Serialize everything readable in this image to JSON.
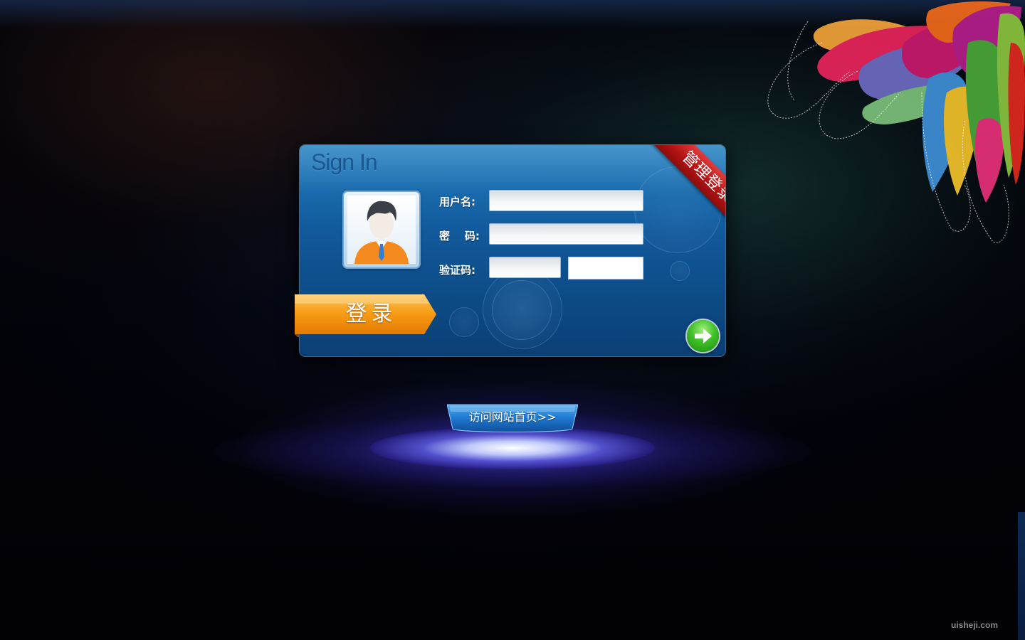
{
  "panel": {
    "title": "Sign In",
    "ribbon_label": "管理登录"
  },
  "form": {
    "username_label": "用户名:",
    "password_label": "密    码:",
    "captcha_label": "验证码:",
    "username_value": "",
    "password_value": "",
    "captcha_value": ""
  },
  "actions": {
    "login_label": "登录",
    "home_link_label": "访问网站首页>>"
  },
  "footer": {
    "watermark": "uisheji.com"
  },
  "icons": {
    "avatar": "user-avatar-icon",
    "go": "arrow-right-icon"
  },
  "colors": {
    "panel_blue": "#125a9c",
    "ribbon_red": "#c41e1e",
    "login_orange": "#f39a12",
    "go_green": "#3fbf27",
    "home_blue": "#1f78d0"
  }
}
